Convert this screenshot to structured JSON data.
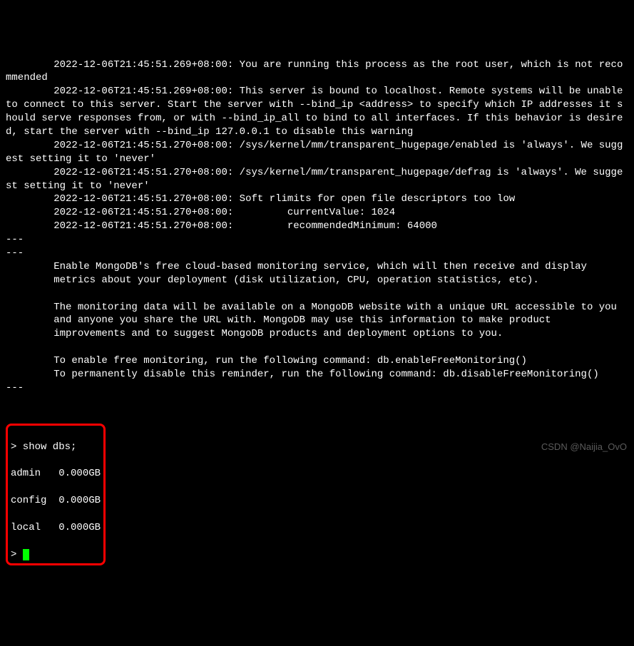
{
  "log_lines": [
    "        2022-12-06T21:45:51.269+08:00: You are running this process as the root user, which is not recommended",
    "        2022-12-06T21:45:51.269+08:00: This server is bound to localhost. Remote systems will be unable to connect to this server. Start the server with --bind_ip <address> to specify which IP addresses it should serve responses from, or with --bind_ip_all to bind to all interfaces. If this behavior is desired, start the server with --bind_ip 127.0.0.1 to disable this warning",
    "        2022-12-06T21:45:51.270+08:00: /sys/kernel/mm/transparent_hugepage/enabled is 'always'. We suggest setting it to 'never'",
    "        2022-12-06T21:45:51.270+08:00: /sys/kernel/mm/transparent_hugepage/defrag is 'always'. We suggest setting it to 'never'",
    "        2022-12-06T21:45:51.270+08:00: Soft rlimits for open file descriptors too low",
    "        2022-12-06T21:45:51.270+08:00:         currentValue: 1024",
    "        2022-12-06T21:45:51.270+08:00:         recommendedMinimum: 64000",
    "---",
    "---",
    "        Enable MongoDB's free cloud-based monitoring service, which will then receive and display",
    "        metrics about your deployment (disk utilization, CPU, operation statistics, etc).",
    "",
    "        The monitoring data will be available on a MongoDB website with a unique URL accessible to you",
    "        and anyone you share the URL with. MongoDB may use this information to make product",
    "        improvements and to suggest MongoDB products and deployment options to you.",
    "",
    "        To enable free monitoring, run the following command: db.enableFreeMonitoring()",
    "        To permanently disable this reminder, run the following command: db.disableFreeMonitoring()",
    "---"
  ],
  "shell": {
    "command_line": "> show dbs;",
    "results": [
      "admin   0.000GB",
      "config  0.000GB",
      "local   0.000GB"
    ],
    "prompt": "> "
  },
  "watermark": "CSDN @Naijia_OvO"
}
